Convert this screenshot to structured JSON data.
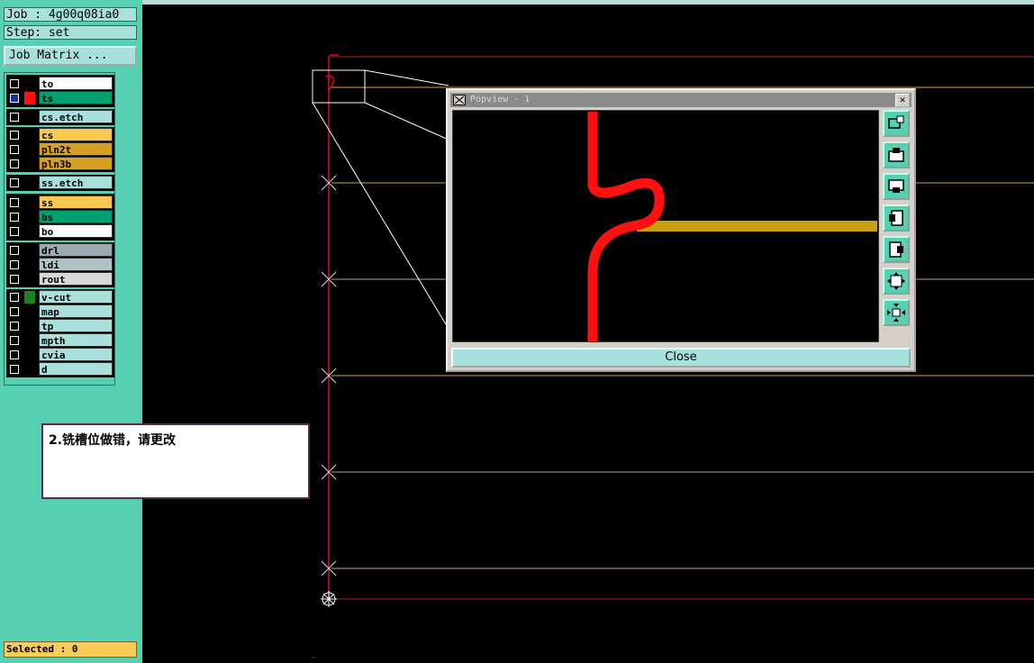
{
  "job_label": "Job : 4g00q08ia0",
  "step_label": "Step: set",
  "job_matrix_button": "Job Matrix ...",
  "layers": [
    {
      "name": "to",
      "name_bg": "#ffffff",
      "swatch": "#000000",
      "checked": false
    },
    {
      "name": "ts",
      "name_bg": "#00a070",
      "swatch": "#ff1010",
      "checked": true,
      "active": true
    },
    {
      "name": "cs.etch",
      "name_bg": "#a8e0dc",
      "swatch": "#000000",
      "checked": false
    },
    {
      "name": "cs",
      "name_bg": "#f8c850",
      "swatch": "#000000",
      "checked": false
    },
    {
      "name": "pln2t",
      "name_bg": "#d8a020",
      "swatch": "#000000",
      "checked": false
    },
    {
      "name": "pln3b",
      "name_bg": "#d8a020",
      "swatch": "#000000",
      "checked": false
    },
    {
      "name": "ss.etch",
      "name_bg": "#a8e0dc",
      "swatch": "#000000",
      "checked": false
    },
    {
      "name": "ss",
      "name_bg": "#f8c850",
      "swatch": "#000000",
      "checked": false
    },
    {
      "name": "bs",
      "name_bg": "#00a070",
      "swatch": "#000000",
      "checked": false
    },
    {
      "name": "bo",
      "name_bg": "#ffffff",
      "swatch": "#000000",
      "checked": false
    },
    {
      "name": "drl",
      "name_bg": "#9aaab0",
      "swatch": "#000000",
      "checked": false
    },
    {
      "name": "ldi",
      "name_bg": "#b0c4c8",
      "swatch": "#000000",
      "checked": false
    },
    {
      "name": "rout",
      "name_bg": "#d8d8d8",
      "swatch": "#000000",
      "checked": false
    },
    {
      "name": "v-cut",
      "name_bg": "#a8e0dc",
      "swatch": "#208020",
      "checked": false
    },
    {
      "name": "map",
      "name_bg": "#a8e0dc",
      "swatch": "#000000",
      "checked": false
    },
    {
      "name": "tp",
      "name_bg": "#a8e0dc",
      "swatch": "#000000",
      "checked": false
    },
    {
      "name": "mpth",
      "name_bg": "#a8e0dc",
      "swatch": "#000000",
      "checked": false
    },
    {
      "name": "cvia",
      "name_bg": "#a8e0dc",
      "swatch": "#000000",
      "checked": false
    },
    {
      "name": "d",
      "name_bg": "#a8e0dc",
      "swatch": "#000000",
      "checked": false
    }
  ],
  "selected_status": "Selected : 0",
  "annotation_note": "2.铣槽位做错，请更改",
  "popview": {
    "title": "Popview - 1",
    "close_button": "Close",
    "tools": [
      "zoom-fit-icon",
      "pan-up-icon",
      "pan-down-icon",
      "pan-left-icon",
      "pan-right-icon",
      "zoom-in-icon",
      "zoom-out-icon"
    ]
  },
  "colors": {
    "route": "#e01010",
    "trace": "#c8a010",
    "guide": "#d0a060",
    "panel": "#56d0b0"
  }
}
